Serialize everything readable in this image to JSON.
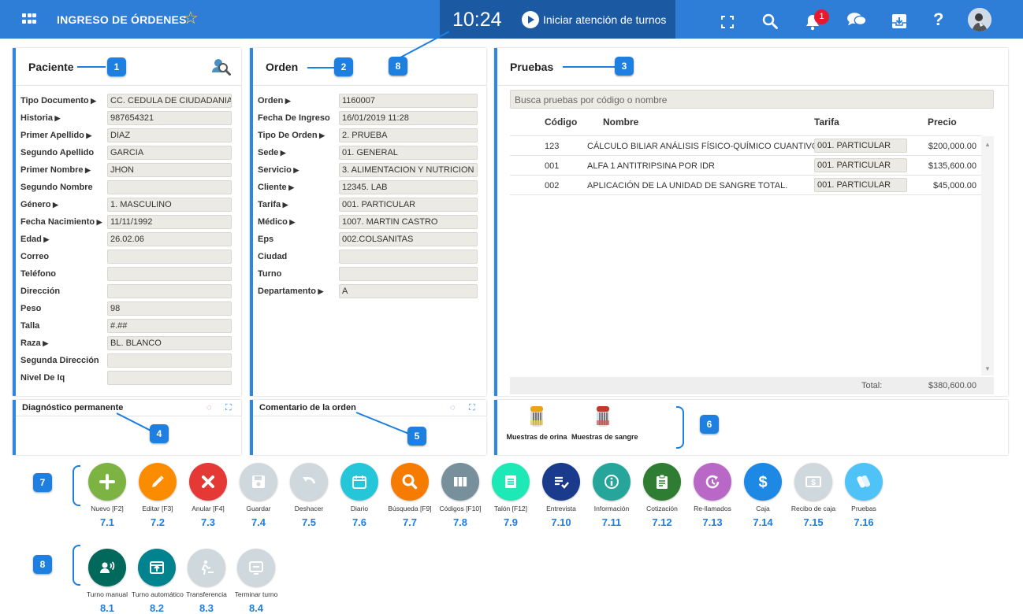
{
  "header": {
    "title": "INGRESO DE ÓRDENES",
    "clock": "10:24",
    "turns_label": "Iniciar atención de turnos",
    "notification_count": "1",
    "accent_color": "#2e7dd6",
    "clock_bg": "#1c59a3"
  },
  "patient": {
    "title": "Paciente",
    "fields": [
      {
        "label": "Tipo Documento",
        "arrow": true,
        "value": "CC. CEDULA DE CIUDADANIA"
      },
      {
        "label": "Historia",
        "arrow": true,
        "value": "987654321"
      },
      {
        "label": "Primer Apellido",
        "arrow": true,
        "value": "DIAZ"
      },
      {
        "label": "Segundo Apellido",
        "arrow": false,
        "value": "GARCIA"
      },
      {
        "label": "Primer Nombre",
        "arrow": true,
        "value": "JHON"
      },
      {
        "label": "Segundo Nombre",
        "arrow": false,
        "value": ""
      },
      {
        "label": "Género",
        "arrow": true,
        "value": "1. MASCULINO"
      },
      {
        "label": "Fecha Nacimiento",
        "arrow": true,
        "value": "11/11/1992"
      },
      {
        "label": "Edad",
        "arrow": true,
        "value": "26.02.06"
      },
      {
        "label": "Correo",
        "arrow": false,
        "value": ""
      },
      {
        "label": "Teléfono",
        "arrow": false,
        "value": ""
      },
      {
        "label": "Dirección",
        "arrow": false,
        "value": ""
      },
      {
        "label": "Peso",
        "arrow": false,
        "value": "98"
      },
      {
        "label": "Talla",
        "arrow": false,
        "value": "#.##"
      },
      {
        "label": "Raza",
        "arrow": true,
        "value": "BL. BLANCO"
      },
      {
        "label": "Segunda Dirección",
        "arrow": false,
        "value": ""
      },
      {
        "label": "Nivel De Iq",
        "arrow": false,
        "value": ""
      }
    ]
  },
  "order": {
    "title": "Orden",
    "fields": [
      {
        "label": "Orden",
        "arrow": true,
        "value": "1160007"
      },
      {
        "label": "Fecha De Ingreso",
        "arrow": false,
        "value": "16/01/2019 11:28"
      },
      {
        "label": "Tipo De Orden",
        "arrow": true,
        "value": "2. PRUEBA"
      },
      {
        "label": "Sede",
        "arrow": true,
        "value": "01. GENERAL"
      },
      {
        "label": "Servicio",
        "arrow": true,
        "value": "3. ALIMENTACION Y NUTRICION"
      },
      {
        "label": "Cliente",
        "arrow": true,
        "value": "12345. LAB"
      },
      {
        "label": "Tarifa",
        "arrow": true,
        "value": "001. PARTICULAR"
      },
      {
        "label": "Médico",
        "arrow": true,
        "value": "1007. MARTIN CASTRO"
      },
      {
        "label": "Eps",
        "arrow": false,
        "value": "002.COLSANITAS"
      },
      {
        "label": "Ciudad",
        "arrow": false,
        "value": ""
      },
      {
        "label": "Turno",
        "arrow": false,
        "value": ""
      },
      {
        "label": "Departamento",
        "arrow": true,
        "value": "A"
      }
    ]
  },
  "tests": {
    "title": "Pruebas",
    "search_placeholder": "Busca pruebas por código o nombre",
    "columns": {
      "code": "Código",
      "name": "Nombre",
      "rate": "Tarifa",
      "price": "Precio"
    },
    "rows": [
      {
        "code": "123",
        "name": "CÁLCULO BILIAR ANÁLISIS FÍSICO-QUÍMICO CUANTIVO",
        "rate": "001. PARTICULAR",
        "price": "$200,000.00"
      },
      {
        "code": "001",
        "name": "ALFA 1 ANTITRIPSINA POR IDR",
        "rate": "001. PARTICULAR",
        "price": "$135,600.00"
      },
      {
        "code": "002",
        "name": "APLICACIÓN DE LA UNIDAD DE SANGRE TOTAL.",
        "rate": "001. PARTICULAR",
        "price": "$45,000.00"
      }
    ],
    "total_label": "Total:",
    "total_value": "$380,600.00"
  },
  "diagnosis": {
    "title": "Diagnóstico permanente"
  },
  "comment": {
    "title": "Comentario de la orden"
  },
  "samples": [
    {
      "label": "Muestras de orina"
    },
    {
      "label": "Muestras de sangre"
    }
  ],
  "callouts": {
    "c1": "1",
    "c2": "2",
    "c3": "3",
    "c4": "4",
    "c5": "5",
    "c6": "6",
    "c7": "7",
    "c8a": "8",
    "c8b": "8"
  },
  "actions": [
    {
      "label": "Nuevo [F2]",
      "num": "7.1",
      "color": "#7cb342",
      "icon": "plus-icon"
    },
    {
      "label": "Editar [F3]",
      "num": "7.2",
      "color": "#fb8c00",
      "icon": "pencil-icon"
    },
    {
      "label": "Anular [F4]",
      "num": "7.3",
      "color": "#e53935",
      "icon": "x-icon"
    },
    {
      "label": "Guardar",
      "num": "7.4",
      "color": "#cfd8dc",
      "icon": "save-icon"
    },
    {
      "label": "Deshacer",
      "num": "7.5",
      "color": "#cfd8dc",
      "icon": "undo-icon"
    },
    {
      "label": "Diario",
      "num": "7.6",
      "color": "#26c6da",
      "icon": "calendar-icon"
    },
    {
      "label": "Búsqueda [F9]",
      "num": "7.7",
      "color": "#f57c00",
      "icon": "search-icon"
    },
    {
      "label": "Códigos [F10]",
      "num": "7.8",
      "color": "#78909c",
      "icon": "columns-icon"
    },
    {
      "label": "Talón [F12]",
      "num": "7.9",
      "color": "#1de9b6",
      "icon": "receipt-icon"
    },
    {
      "label": "Entrevista",
      "num": "7.10",
      "color": "#1a3a8c",
      "icon": "checklist-icon"
    },
    {
      "label": "Información",
      "num": "7.11",
      "color": "#26a69a",
      "icon": "info-icon"
    },
    {
      "label": "Cotización",
      "num": "7.12",
      "color": "#2e7d32",
      "icon": "clipboard-icon"
    },
    {
      "label": "Re-llamados",
      "num": "7.13",
      "color": "#ba68c8",
      "icon": "recall-icon"
    },
    {
      "label": "Caja",
      "num": "7.14",
      "color": "#1e88e5",
      "icon": "dollar-icon"
    },
    {
      "label": "Recibo de caja",
      "num": "7.15",
      "color": "#cfd8dc",
      "icon": "cash-receipt-icon"
    },
    {
      "label": "Pruebas",
      "num": "7.16",
      "color": "#4fc3f7",
      "icon": "tubes-icon"
    }
  ],
  "turn_actions": [
    {
      "label": "Turno manual",
      "num": "8.1",
      "color": "#00695c",
      "icon": "announce-icon"
    },
    {
      "label": "Turno automático",
      "num": "8.2",
      "color": "#00838f",
      "icon": "auto-turn-icon"
    },
    {
      "label": "Transferencia",
      "num": "8.3",
      "color": "#cfd8dc",
      "icon": "transfer-icon"
    },
    {
      "label": "Terminar turno",
      "num": "8.4",
      "color": "#cfd8dc",
      "icon": "end-turn-icon"
    }
  ]
}
